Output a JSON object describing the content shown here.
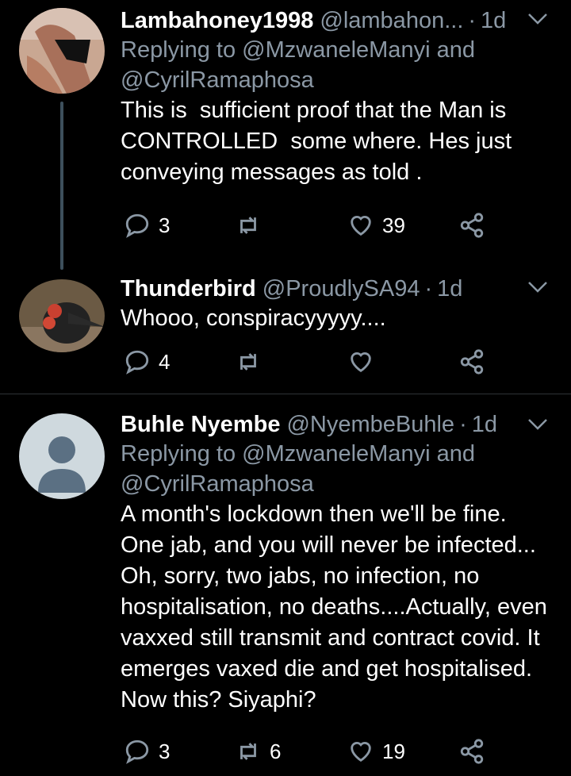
{
  "colors": {
    "background": "#000000",
    "secondary_text": "#8b98a5",
    "divider": "#2f3336"
  },
  "tweets": [
    {
      "display_name": "Lambahoney1998",
      "handle": "@lambahon...",
      "dot": "·",
      "time": "1d",
      "replying_prefix": "Replying to",
      "replying_users": [
        "@MzwaneleManyi",
        "and",
        "@CyrilRamaphosa"
      ],
      "text": "This is  sufficient proof that the Man is CONTROLLED  some where. Hes just conveying messages as told .",
      "replies": "3",
      "retweets": "",
      "likes": "39"
    },
    {
      "display_name": "Thunderbird",
      "handle": "@ProudlySA94",
      "dot": "·",
      "time": "1d",
      "text": "Whooo, conspiracyyyyy....",
      "replies": "4",
      "retweets": "",
      "likes": ""
    },
    {
      "display_name": "Buhle Nyembe",
      "handle": "@NyembeBuhle",
      "dot": "·",
      "time": "1d",
      "replying_prefix": "Replying to",
      "replying_users": [
        "@MzwaneleManyi",
        "and",
        "@CyrilRamaphosa"
      ],
      "text": "A month's lockdown then we'll be fine. One jab, and you will never be infected... Oh, sorry, two jabs, no infection, no hospitalisation, no deaths....Actually, even vaxxed still transmit and contract covid. It emerges vaxed die and get hospitalised. Now this? Siyaphi?",
      "replies": "3",
      "retweets": "6",
      "likes": "19"
    }
  ],
  "icons": {
    "reply": "reply-icon",
    "retweet": "retweet-icon",
    "like": "heart-icon",
    "share": "share-icon",
    "more": "chevron-down-icon"
  }
}
